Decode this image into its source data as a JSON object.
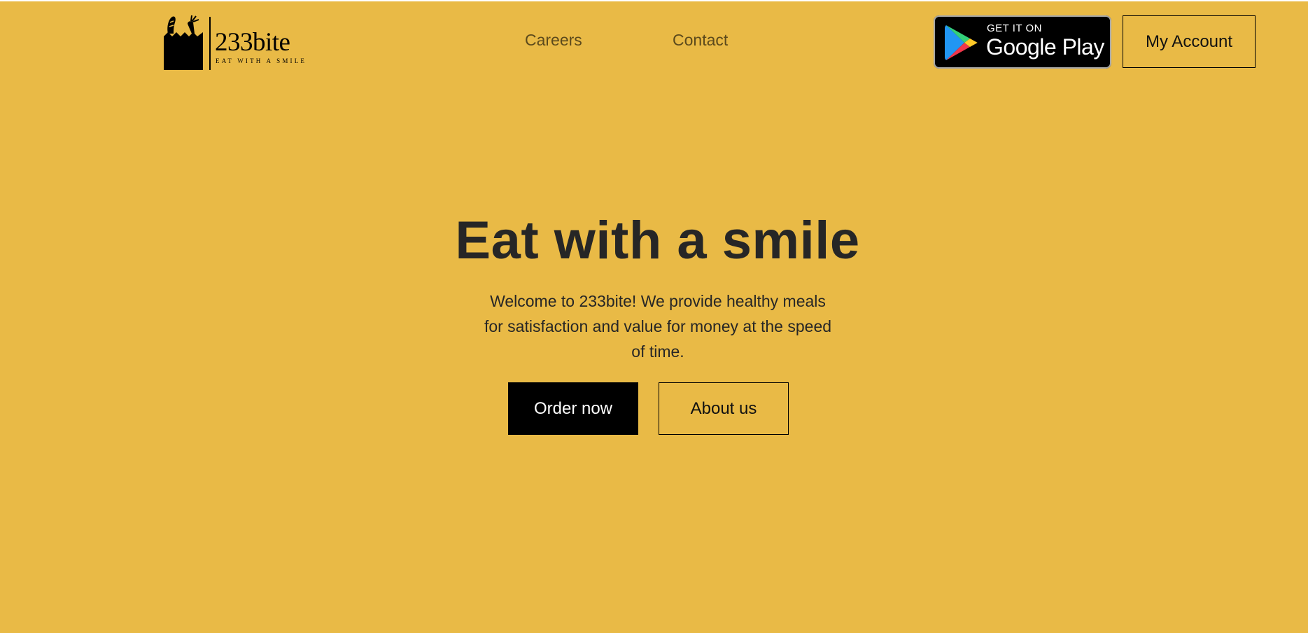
{
  "brand": {
    "name": "233bite",
    "tagline": "EAT WITH A SMILE",
    "logo_icon": "grocery-bag-icon"
  },
  "nav": {
    "items": [
      {
        "label": "Careers"
      },
      {
        "label": "Contact"
      }
    ]
  },
  "header": {
    "store_badge": {
      "small_text": "GET IT ON",
      "store_name": "Google Play",
      "icon": "google-play-icon"
    },
    "account_label": "My Account"
  },
  "hero": {
    "title": "Eat with a smile",
    "subtitle": "Welcome to 233bite! We provide healthy meals for satisfaction and value for money at the speed of time.",
    "primary_cta": "Order now",
    "secondary_cta": "About us"
  },
  "colors": {
    "background": "#E9BA46",
    "text": "#262626",
    "primary_button": "#000000"
  }
}
